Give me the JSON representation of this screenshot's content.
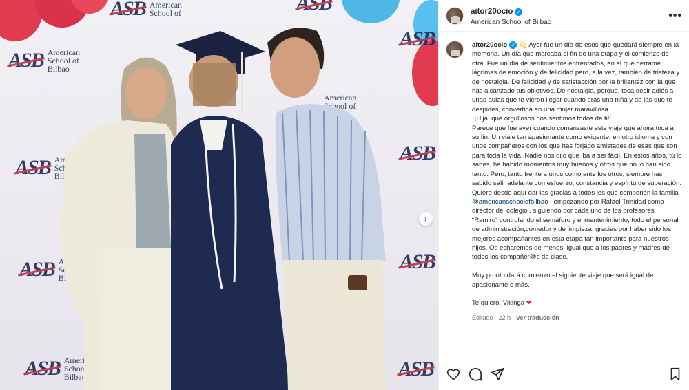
{
  "post": {
    "username": "aitor20ocio",
    "location": "American School of Bilbao",
    "more_icon": "more-horizontal-icon"
  },
  "caption": {
    "p1": "💫 Ayer fue un día de esos que quedará siempre en la memoria. Un día que marcaba el fin de una etapa y el comienzo de otra. Fue un día de sentimientos enfrentados, en el que derramé lágrimas de emoción y de felicidad pero, a la vez, también de tristeza y de nostalgia. De felicidad y de satisfacción por la brillantez con la que has alcanzado tus objetivos. De nostalgia, porque, toca decir adiós a unas aulas que te vieron llegar cuando eras una niña y de las que te despides, convertida en una mujer maravillosa.",
    "p2": "¡¡Hija, qué orgullosos nos sentimos todos de ti!!",
    "p3": "Parece que fue ayer cuando comenzaste este viaje que ahora toca a su fin. Un viaje tan apasionante como exigente, en otro idioma y con unos compañeros con los que has forjado amistades de esas que son para toda la vida. Nadie nos dijo que iba a ser fácil. En estos años, tú lo sabes, ha habido momentos muy buenos y otros que no lo han sido tanto. Pero, tanto frente a unos como ante los otros, siempre has sabido salir adelante con esfuerzo, constancia y espíritu de superación.",
    "p4_before": "Quiero desde aquí dar las gracias a todos los que componen la familia ",
    "mention": "@americanschoolofbilbao",
    "p4_after": " , empezando por Rafael Trinidad como director del colegio , siguiendo por cada uno de los profesores, “Ramiro” controlando el semáforo y el mantenimiento, todo el personal de administración,comedor y de limpieza: gracias por haber sido los mejores acompañantes en esta etapa tan importante para nuestros hijos. Os echaremos de menos, igual que a los padres y madres de todos los compañer@s de clase.",
    "p5": "Muy pronto dará comienzo el siguiente viaje que será igual de apasionante o más.",
    "p6": "Te quiero, Vikinga ",
    "heart": "❤",
    "edited": "Editado · 22 h",
    "translate": "Ver traducción"
  },
  "photo": {
    "logo_mark": "ASB",
    "logo_line1": "American",
    "logo_line2": "School of",
    "logo_line3": "Bilbao",
    "next_arrow": "›"
  },
  "icons": {
    "like": "heart-icon",
    "comment": "comment-icon",
    "share": "send-icon",
    "save": "bookmark-icon"
  },
  "colors": {
    "accent": "#0095f6",
    "mention": "#00376b",
    "backdrop_navy": "#1f2a5a",
    "backdrop_red": "#c22b3a",
    "balloon_red": "#e23a4f",
    "balloon_blue": "#4fb7e6"
  }
}
